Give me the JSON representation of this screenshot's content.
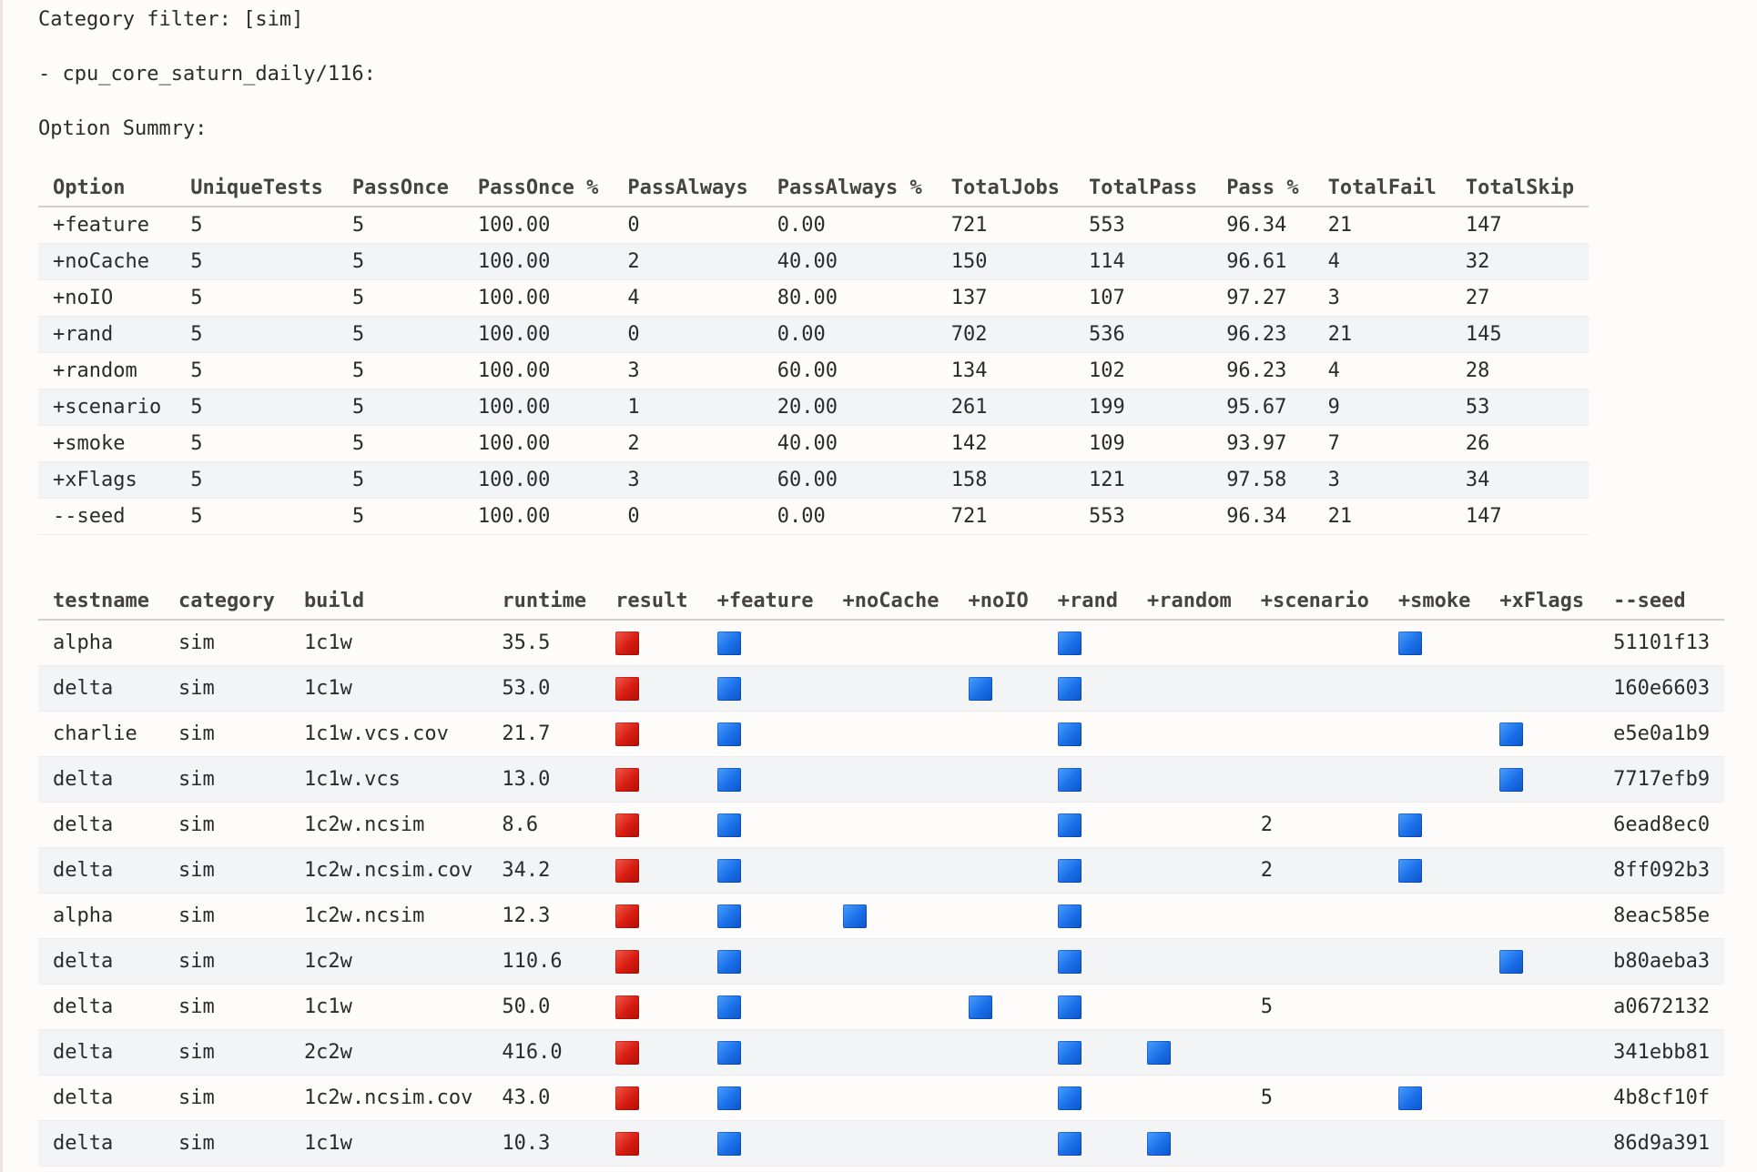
{
  "header": {
    "filter_line": "Category filter: [sim]",
    "job_line": "- cpu_core_saturn_daily/116:",
    "summary_title": "Option Summry:"
  },
  "summary": {
    "columns": [
      "Option",
      "UniqueTests",
      "PassOnce",
      "PassOnce %",
      "PassAlways",
      "PassAlways %",
      "TotalJobs",
      "TotalPass",
      "Pass %",
      "TotalFail",
      "TotalSkip"
    ],
    "rows": [
      [
        "+feature",
        "5",
        "5",
        "100.00",
        "0",
        "0.00",
        "721",
        "553",
        "96.34",
        "21",
        "147"
      ],
      [
        "+noCache",
        "5",
        "5",
        "100.00",
        "2",
        "40.00",
        "150",
        "114",
        "96.61",
        "4",
        "32"
      ],
      [
        "+noIO",
        "5",
        "5",
        "100.00",
        "4",
        "80.00",
        "137",
        "107",
        "97.27",
        "3",
        "27"
      ],
      [
        "+rand",
        "5",
        "5",
        "100.00",
        "0",
        "0.00",
        "702",
        "536",
        "96.23",
        "21",
        "145"
      ],
      [
        "+random",
        "5",
        "5",
        "100.00",
        "3",
        "60.00",
        "134",
        "102",
        "96.23",
        "4",
        "28"
      ],
      [
        "+scenario",
        "5",
        "5",
        "100.00",
        "1",
        "20.00",
        "261",
        "199",
        "95.67",
        "9",
        "53"
      ],
      [
        "+smoke",
        "5",
        "5",
        "100.00",
        "2",
        "40.00",
        "142",
        "109",
        "93.97",
        "7",
        "26"
      ],
      [
        "+xFlags",
        "5",
        "5",
        "100.00",
        "3",
        "60.00",
        "158",
        "121",
        "97.58",
        "3",
        "34"
      ],
      [
        "--seed",
        "5",
        "5",
        "100.00",
        "0",
        "0.00",
        "721",
        "553",
        "96.34",
        "21",
        "147"
      ]
    ]
  },
  "results": {
    "columns": [
      "testname",
      "category",
      "build",
      "runtime",
      "result",
      "+feature",
      "+noCache",
      "+noIO",
      "+rand",
      "+random",
      "+scenario",
      "+smoke",
      "+xFlags",
      "--seed"
    ],
    "legend": {
      "fail_color": "#d61c10",
      "option_color": "#1a6fe8",
      "fail_icon": "red-square",
      "option_icon": "blue-square"
    },
    "rows": [
      {
        "testname": "alpha",
        "category": "sim",
        "build": "1c1w",
        "runtime": "35.5",
        "result": "fail",
        "feature": true,
        "noCache": false,
        "noIO": false,
        "rand": true,
        "random": false,
        "scenario": "",
        "smoke": true,
        "xFlags": false,
        "seed": "51101f13"
      },
      {
        "testname": "delta",
        "category": "sim",
        "build": "1c1w",
        "runtime": "53.0",
        "result": "fail",
        "feature": true,
        "noCache": false,
        "noIO": true,
        "rand": true,
        "random": false,
        "scenario": "",
        "smoke": false,
        "xFlags": false,
        "seed": "160e6603"
      },
      {
        "testname": "charlie",
        "category": "sim",
        "build": "1c1w.vcs.cov",
        "runtime": "21.7",
        "result": "fail",
        "feature": true,
        "noCache": false,
        "noIO": false,
        "rand": true,
        "random": false,
        "scenario": "",
        "smoke": false,
        "xFlags": true,
        "seed": "e5e0a1b9"
      },
      {
        "testname": "delta",
        "category": "sim",
        "build": "1c1w.vcs",
        "runtime": "13.0",
        "result": "fail",
        "feature": true,
        "noCache": false,
        "noIO": false,
        "rand": true,
        "random": false,
        "scenario": "",
        "smoke": false,
        "xFlags": true,
        "seed": "7717efb9"
      },
      {
        "testname": "delta",
        "category": "sim",
        "build": "1c2w.ncsim",
        "runtime": "8.6",
        "result": "fail",
        "feature": true,
        "noCache": false,
        "noIO": false,
        "rand": true,
        "random": false,
        "scenario": "2",
        "smoke": true,
        "xFlags": false,
        "seed": "6ead8ec0"
      },
      {
        "testname": "delta",
        "category": "sim",
        "build": "1c2w.ncsim.cov",
        "runtime": "34.2",
        "result": "fail",
        "feature": true,
        "noCache": false,
        "noIO": false,
        "rand": true,
        "random": false,
        "scenario": "2",
        "smoke": true,
        "xFlags": false,
        "seed": "8ff092b3"
      },
      {
        "testname": "alpha",
        "category": "sim",
        "build": "1c2w.ncsim",
        "runtime": "12.3",
        "result": "fail",
        "feature": true,
        "noCache": true,
        "noIO": false,
        "rand": true,
        "random": false,
        "scenario": "",
        "smoke": false,
        "xFlags": false,
        "seed": "8eac585e"
      },
      {
        "testname": "delta",
        "category": "sim",
        "build": "1c2w",
        "runtime": "110.6",
        "result": "fail",
        "feature": true,
        "noCache": false,
        "noIO": false,
        "rand": true,
        "random": false,
        "scenario": "",
        "smoke": false,
        "xFlags": true,
        "seed": "b80aeba3"
      },
      {
        "testname": "delta",
        "category": "sim",
        "build": "1c1w",
        "runtime": "50.0",
        "result": "fail",
        "feature": true,
        "noCache": false,
        "noIO": true,
        "rand": true,
        "random": false,
        "scenario": "5",
        "smoke": false,
        "xFlags": false,
        "seed": "a0672132"
      },
      {
        "testname": "delta",
        "category": "sim",
        "build": "2c2w",
        "runtime": "416.0",
        "result": "fail",
        "feature": true,
        "noCache": false,
        "noIO": false,
        "rand": true,
        "random": true,
        "scenario": "",
        "smoke": false,
        "xFlags": false,
        "seed": "341ebb81"
      },
      {
        "testname": "delta",
        "category": "sim",
        "build": "1c2w.ncsim.cov",
        "runtime": "43.0",
        "result": "fail",
        "feature": true,
        "noCache": false,
        "noIO": false,
        "rand": true,
        "random": false,
        "scenario": "5",
        "smoke": true,
        "xFlags": false,
        "seed": "4b8cf10f"
      },
      {
        "testname": "delta",
        "category": "sim",
        "build": "1c1w",
        "runtime": "10.3",
        "result": "fail",
        "feature": true,
        "noCache": false,
        "noIO": false,
        "rand": true,
        "random": true,
        "scenario": "",
        "smoke": false,
        "xFlags": false,
        "seed": "86d9a391"
      }
    ]
  }
}
